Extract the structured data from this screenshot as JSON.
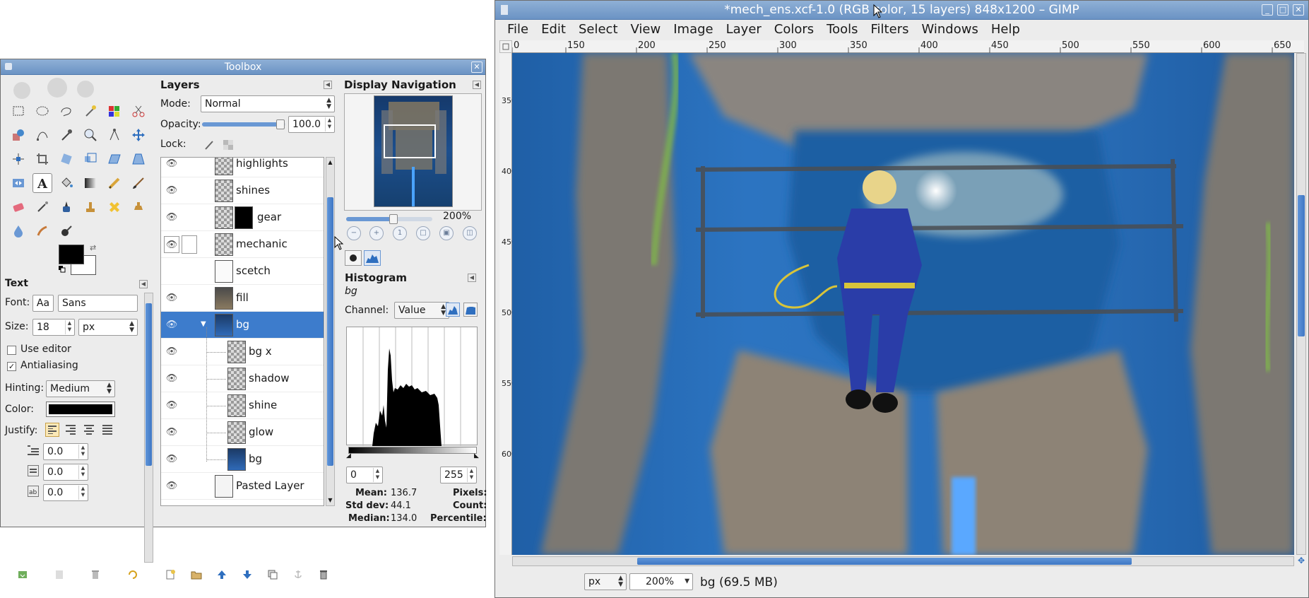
{
  "toolbox": {
    "title": "Toolbox",
    "text_panel": {
      "title": "Text",
      "font_label": "Font:",
      "font_button": "Aa",
      "font_value": "Sans",
      "size_label": "Size:",
      "size_value": "18",
      "size_unit": "px",
      "use_editor": "Use editor",
      "antialiasing": "Antialiasing",
      "hinting_label": "Hinting:",
      "hinting_value": "Medium",
      "color_label": "Color:",
      "justify_label": "Justify:",
      "indent_value": "0.0",
      "line_spacing_value": "0.0",
      "letter_spacing_value": "0.0"
    }
  },
  "layers": {
    "title": "Layers",
    "mode_label": "Mode:",
    "mode_value": "Normal",
    "opacity_label": "Opacity:",
    "opacity_value": "100.0",
    "opacity_fraction": 0.94,
    "lock_label": "Lock:",
    "items": [
      {
        "name": "highlights"
      },
      {
        "name": "shines"
      },
      {
        "name": "gear"
      },
      {
        "name": "mechanic"
      },
      {
        "name": "scetch"
      },
      {
        "name": "fill"
      },
      {
        "name": "bg"
      },
      {
        "name": "bg x"
      },
      {
        "name": "shadow"
      },
      {
        "name": "shine"
      },
      {
        "name": "glow"
      },
      {
        "name": "bg"
      },
      {
        "name": "Pasted Layer"
      }
    ]
  },
  "navigation": {
    "title": "Display Navigation",
    "zoom_value": "200%",
    "zoom_fraction": 0.55
  },
  "histogram": {
    "title": "Histogram",
    "layer_name": "bg",
    "channel_label": "Channel:",
    "channel_value": "Value",
    "range_min": "0",
    "range_max": "255",
    "mean_label": "Mean:",
    "mean_value": "136.7",
    "std_label": "Std dev:",
    "std_value": "44.1",
    "median_label": "Median:",
    "median_value": "134.0",
    "pixels_label": "Pixels:",
    "count_label": "Count:",
    "percentile_label": "Percentile:"
  },
  "image_window": {
    "title": "*mech_ens.xcf-1.0 (RGB color, 15 layers) 848x1200 – GIMP",
    "menu": [
      "File",
      "Edit",
      "Select",
      "View",
      "Image",
      "Layer",
      "Colors",
      "Tools",
      "Filters",
      "Windows",
      "Help"
    ],
    "ruler_h_labels": [
      "0",
      "150",
      "200",
      "250",
      "300",
      "350",
      "400",
      "450",
      "500",
      "550",
      "600",
      "650"
    ],
    "ruler_v_labels": [
      "350",
      "400",
      "450",
      "500",
      "550",
      "600"
    ],
    "status": {
      "unit": "px",
      "zoom": "200%",
      "layer_info": "bg (69.5 MB)"
    }
  },
  "colors": {
    "title_bar": "#7a9fcf",
    "selection": "#3d7ccc",
    "canvas_blue": "#2a6fb9"
  }
}
